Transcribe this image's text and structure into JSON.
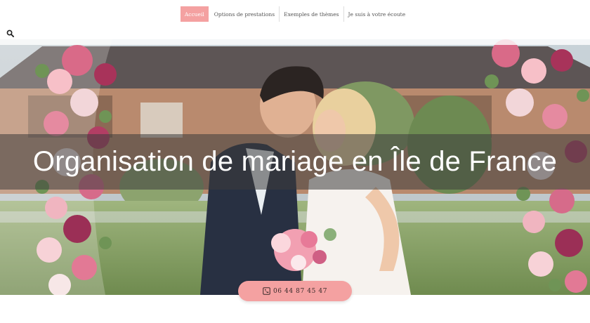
{
  "nav": {
    "items": [
      {
        "label": "Accueil",
        "active": true
      },
      {
        "label": "Options de prestations",
        "active": false
      },
      {
        "label": "Exemples de thèmes",
        "active": false
      },
      {
        "label": "Je suis à votre écoute",
        "active": false
      }
    ]
  },
  "icons": {
    "search": "search-icon",
    "phone": "phone-icon"
  },
  "hero": {
    "title": "Organisation de mariage en Île de France"
  },
  "cta": {
    "phone": "06 44 87 45 47"
  },
  "colors": {
    "accent": "#f4a1a1",
    "title_band": "rgba(60,60,60,0.55)"
  }
}
